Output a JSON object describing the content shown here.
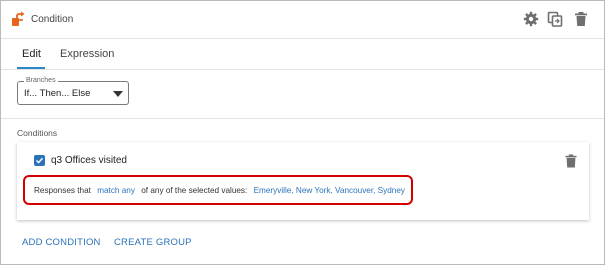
{
  "header": {
    "title": "Condition",
    "icons": [
      "condition-logo",
      "gear",
      "copy",
      "trash"
    ]
  },
  "tabs": [
    {
      "label": "Edit",
      "active": true
    },
    {
      "label": "Expression",
      "active": false
    }
  ],
  "branches": {
    "legend": "Branches",
    "value": "If... Then... Else"
  },
  "conditions": {
    "label": "Conditions",
    "items": [
      {
        "checked": true,
        "title": "q3 Offices visited",
        "prefix": "Responses that",
        "match": "match any",
        "middle": "of any of the selected values:",
        "values": "Emeryville, New York, Vancouver, Sydney"
      }
    ]
  },
  "actions": {
    "add_condition": "ADD CONDITION",
    "create_group": "CREATE GROUP"
  },
  "colors": {
    "accent": "#2b73b9",
    "tab_underline": "#2b8ac6",
    "highlight": "#d40000",
    "logo": "#e8641b"
  }
}
